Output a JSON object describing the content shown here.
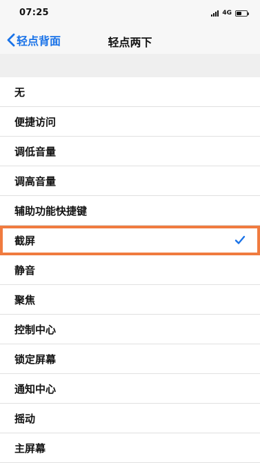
{
  "status_bar": {
    "time": "07:25",
    "network": "4G",
    "signal_icon": "cellular-signal-icon",
    "battery_icon": "battery-icon",
    "battery_level": 0.5
  },
  "nav": {
    "back_label": "轻点背面",
    "back_icon": "chevron-left-icon",
    "title": "轻点两下",
    "accent_color": "#1a73e8"
  },
  "options": [
    {
      "label": "无",
      "selected": false
    },
    {
      "label": "便捷访问",
      "selected": false
    },
    {
      "label": "调低音量",
      "selected": false
    },
    {
      "label": "调高音量",
      "selected": false
    },
    {
      "label": "辅助功能快捷键",
      "selected": false
    },
    {
      "label": "截屏",
      "selected": true,
      "highlighted": true
    },
    {
      "label": "静音",
      "selected": false
    },
    {
      "label": "聚焦",
      "selected": false
    },
    {
      "label": "控制中心",
      "selected": false
    },
    {
      "label": "锁定屏幕",
      "selected": false
    },
    {
      "label": "通知中心",
      "selected": false
    },
    {
      "label": "摇动",
      "selected": false
    },
    {
      "label": "主屏幕",
      "selected": false
    }
  ],
  "colors": {
    "checkmark": "#1a73e8",
    "highlight_border": "#f07b3f",
    "section_background": "#efefef",
    "separator": "#e0e0e0"
  }
}
